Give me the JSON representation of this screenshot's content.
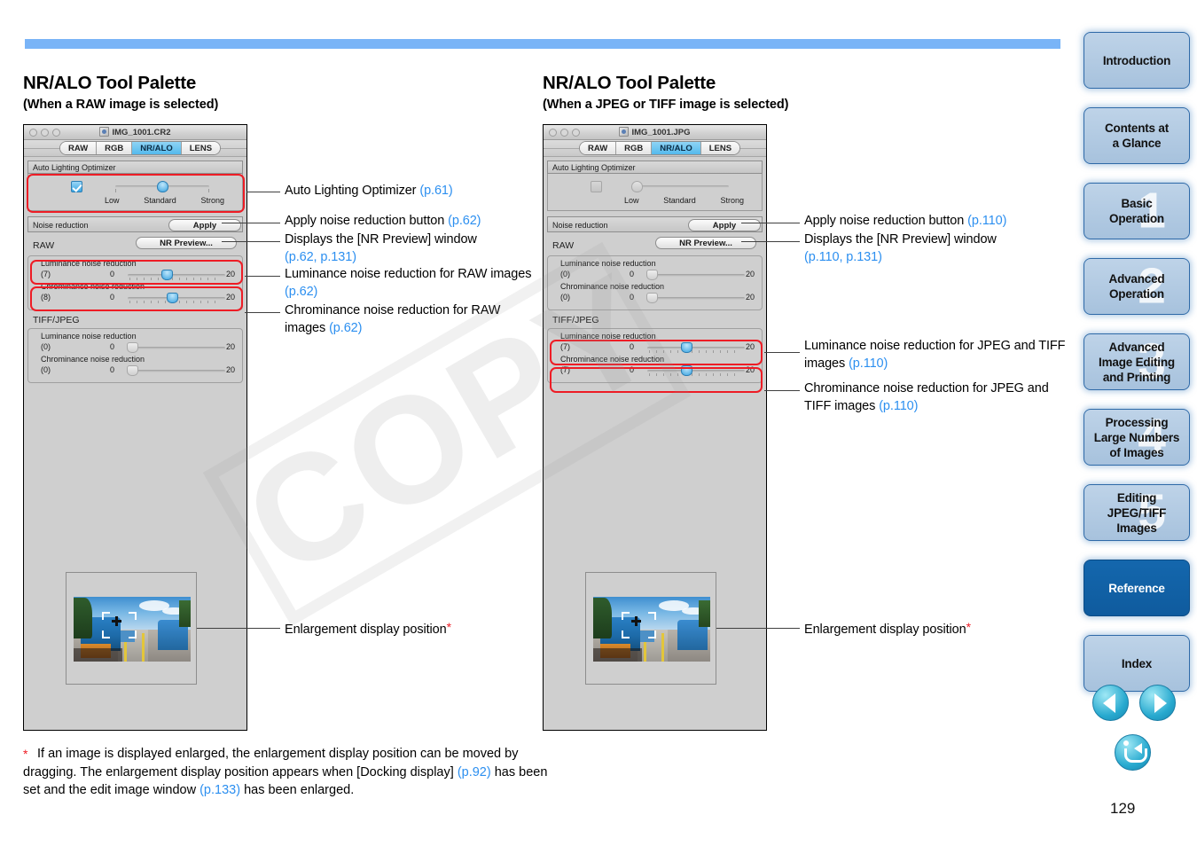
{
  "page": {
    "number": "129"
  },
  "sections": [
    {
      "title": "NR/ALO Tool Palette",
      "subtitle": "(When a RAW image is selected)",
      "window": {
        "file_name": "IMG_1001.CR2",
        "tabs": [
          "RAW",
          "RGB",
          "NR/ALO",
          "LENS"
        ],
        "active_tab": "NR/ALO",
        "alo": {
          "group_label": "Auto Lighting Optimizer",
          "checked": true,
          "slider_labels": [
            "Low",
            "Standard",
            "Strong"
          ],
          "slider_position": "Standard"
        },
        "noise_reduction": {
          "label": "Noise reduction",
          "apply_button": "Apply",
          "preview_button": "NR Preview..."
        },
        "raw_group": {
          "label": "RAW",
          "sliders": [
            {
              "name": "Luminance noise reduction",
              "value": "(7)",
              "min": "0",
              "max": "20",
              "percent": 35,
              "enabled": true
            },
            {
              "name": "Chrominance noise reduction",
              "value": "(8)",
              "min": "0",
              "max": "20",
              "percent": 40,
              "enabled": true
            }
          ]
        },
        "tiff_jpeg_group": {
          "label": "TIFF/JPEG",
          "sliders": [
            {
              "name": "Luminance noise reduction",
              "value": "(0)",
              "min": "0",
              "max": "20",
              "percent": 0,
              "enabled": false
            },
            {
              "name": "Chrominance noise reduction",
              "value": "(0)",
              "min": "0",
              "max": "20",
              "percent": 0,
              "enabled": false
            }
          ]
        }
      },
      "callouts": [
        {
          "text": "Auto Lighting Optimizer ",
          "page_ref": "(p.61)"
        },
        {
          "text": "Apply noise reduction button ",
          "page_ref": "(p.62)"
        },
        {
          "text": "Displays the [NR Preview] window",
          "page_ref": "(p.62, p.131)"
        },
        {
          "text": "Luminance noise reduction for RAW images ",
          "page_ref": "(p.62)"
        },
        {
          "text": "Chrominance noise reduction for RAW images ",
          "page_ref": "(p.62)"
        }
      ],
      "enlargement_label": "Enlargement display position"
    },
    {
      "title": "NR/ALO Tool Palette",
      "subtitle": "(When a JPEG or TIFF image is selected)",
      "window": {
        "file_name": "IMG_1001.JPG",
        "tabs": [
          "RAW",
          "RGB",
          "NR/ALO",
          "LENS"
        ],
        "active_tab": "NR/ALO",
        "alo": {
          "group_label": "Auto Lighting Optimizer",
          "checked": false,
          "slider_labels": [
            "Low",
            "Standard",
            "Strong"
          ],
          "slider_position": "Low"
        },
        "noise_reduction": {
          "label": "Noise reduction",
          "apply_button": "Apply",
          "preview_button": "NR Preview..."
        },
        "raw_group": {
          "label": "RAW",
          "sliders": [
            {
              "name": "Luminance noise reduction",
              "value": "(0)",
              "min": "0",
              "max": "20",
              "percent": 0,
              "enabled": false
            },
            {
              "name": "Chrominance noise reduction",
              "value": "(0)",
              "min": "0",
              "max": "20",
              "percent": 0,
              "enabled": false
            }
          ]
        },
        "tiff_jpeg_group": {
          "label": "TIFF/JPEG",
          "sliders": [
            {
              "name": "Luminance noise reduction",
              "value": "(7)",
              "min": "0",
              "max": "20",
              "percent": 35,
              "enabled": true
            },
            {
              "name": "Chrominance noise reduction",
              "value": "(7)",
              "min": "0",
              "max": "20",
              "percent": 35,
              "enabled": true
            }
          ]
        }
      },
      "callouts": [
        {
          "text": "Apply noise reduction button ",
          "page_ref": "(p.110)"
        },
        {
          "text": "Displays the [NR Preview] window",
          "page_ref": "(p.110, p.131)"
        },
        {
          "text": "Luminance noise reduction for JPEG and TIFF images ",
          "page_ref": "(p.110)"
        },
        {
          "text": "Chrominance noise reduction for JPEG and TIFF images ",
          "page_ref": "(p.110)"
        }
      ],
      "enlargement_label": "Enlargement display position"
    }
  ],
  "footnote": {
    "marker": "*",
    "part1": "If an image is displayed enlarged, the enlargement display position can be moved by dragging. The enlargement display position appears when [Docking display] ",
    "ref1": "(p.92)",
    "part2": " has been set and the edit image window ",
    "ref2": "(p.133)",
    "part3": " has been enlarged."
  },
  "watermark": {
    "text": "COPY"
  },
  "sidebar": {
    "items": [
      {
        "label": "Introduction",
        "number": "",
        "active": false
      },
      {
        "label": "Contents at\na Glance",
        "number": "",
        "active": false
      },
      {
        "label": "Basic\nOperation",
        "number": "1",
        "active": false
      },
      {
        "label": "Advanced\nOperation",
        "number": "2",
        "active": false
      },
      {
        "label": "Advanced\nImage Editing\nand Printing",
        "number": "3",
        "active": false
      },
      {
        "label": "Processing\nLarge Numbers\nof Images",
        "number": "4",
        "active": false
      },
      {
        "label": "Editing\nJPEG/TIFF\nImages",
        "number": "5",
        "active": false
      },
      {
        "label": "Reference",
        "number": "",
        "active": true
      },
      {
        "label": "Index",
        "number": "",
        "active": false
      }
    ],
    "nav": {
      "prev": "previous-page",
      "next": "next-page",
      "back": "go-back"
    }
  },
  "colors": {
    "accent_blue": "#79b4f7",
    "link_blue": "#2c8ff0",
    "callout_red": "#ee1c25",
    "active_nav": "#1467ad"
  }
}
